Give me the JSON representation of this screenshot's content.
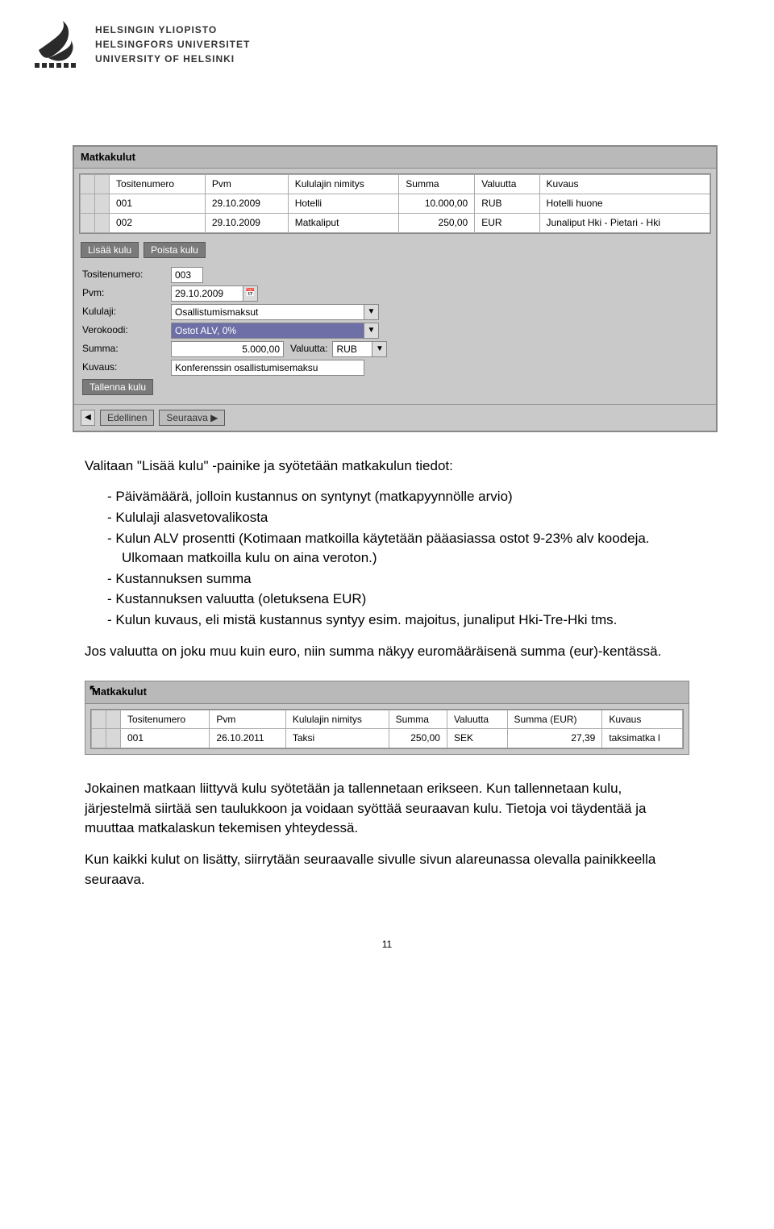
{
  "logo": {
    "line1": "HELSINGIN YLIOPISTO",
    "line2": "HELSINGFORS UNIVERSITET",
    "line3": "UNIVERSITY OF HELSINKI"
  },
  "shot1": {
    "panel_title": "Matkakulut",
    "headers": {
      "c1": "Tositenumero",
      "c2": "Pvm",
      "c3": "Kululajin nimitys",
      "c4": "Summa",
      "c5": "Valuutta",
      "c6": "Kuvaus"
    },
    "rows": [
      {
        "c1": "001",
        "c2": "29.10.2009",
        "c3": "Hotelli",
        "c4": "10.000,00",
        "c5": "RUB",
        "c6": "Hotelli huone"
      },
      {
        "c1": "002",
        "c2": "29.10.2009",
        "c3": "Matkaliput",
        "c4": "250,00",
        "c5": "EUR",
        "c6": "Junaliput Hki - Pietari - Hki"
      }
    ],
    "buttons": {
      "add": "Lisää kulu",
      "remove": "Poista kulu",
      "save": "Tallenna kulu",
      "prev": "Edellinen",
      "next": "Seuraava"
    },
    "form": {
      "l_tosite": "Tositenumero:",
      "v_tosite": "003",
      "l_pvm": "Pvm:",
      "v_pvm": "29.10.2009",
      "l_kululaji": "Kululaji:",
      "v_kululaji": "Osallistumismaksut",
      "l_verokoodi": "Verokoodi:",
      "v_verokoodi": "Ostot ALV, 0%",
      "l_summa": "Summa:",
      "v_summa": "5.000,00",
      "l_valuutta": "Valuutta:",
      "v_valuutta": "RUB",
      "l_kuvaus": "Kuvaus:",
      "v_kuvaus": "Konferenssin osallistumisemaksu"
    }
  },
  "text1": {
    "intro": "Valitaan \"Lisää kulu\" -painike ja syötetään matkakulun tiedot:",
    "items": [
      "Päivämäärä, jolloin kustannus on syntynyt (matkapyynnölle arvio)",
      "Kululaji alasvetovalikosta",
      "Kulun ALV prosentti (Kotimaan matkoilla käytetään pääasiassa ostot 9-23% alv koodeja. Ulkomaan matkoilla kulu on aina veroton.)",
      "Kustannuksen summa",
      "Kustannuksen valuutta (oletuksena EUR)",
      "Kulun kuvaus, eli mistä kustannus syntyy esim. majoitus, junaliput Hki-Tre-Hki tms."
    ],
    "p2": "Jos valuutta on joku muu kuin euro, niin summa näkyy euromääräisenä summa (eur)-kentässä."
  },
  "shot2": {
    "panel_title": "Matkakulut",
    "headers": {
      "c1": "Tositenumero",
      "c2": "Pvm",
      "c3": "Kululajin nimitys",
      "c4": "Summa",
      "c5": "Valuutta",
      "c6": "Summa (EUR)",
      "c7": "Kuvaus"
    },
    "row": {
      "c1": "001",
      "c2": "26.10.2011",
      "c3": "Taksi",
      "c4": "250,00",
      "c5": "SEK",
      "c6": "27,39",
      "c7": "taksimatka l"
    }
  },
  "text2": {
    "p1": "Jokainen matkaan liittyvä kulu syötetään ja tallennetaan erikseen. Kun tallennetaan kulu, järjestelmä siirtää sen taulukkoon ja voidaan syöttää seuraavan kulu. Tietoja voi täydentää ja muuttaa matkalaskun tekemisen yhteydessä.",
    "p2": "Kun kaikki kulut on lisätty, siirrytään seuraavalle sivulle sivun alareunassa olevalla painikkeella seuraava."
  },
  "pagenum": "11"
}
